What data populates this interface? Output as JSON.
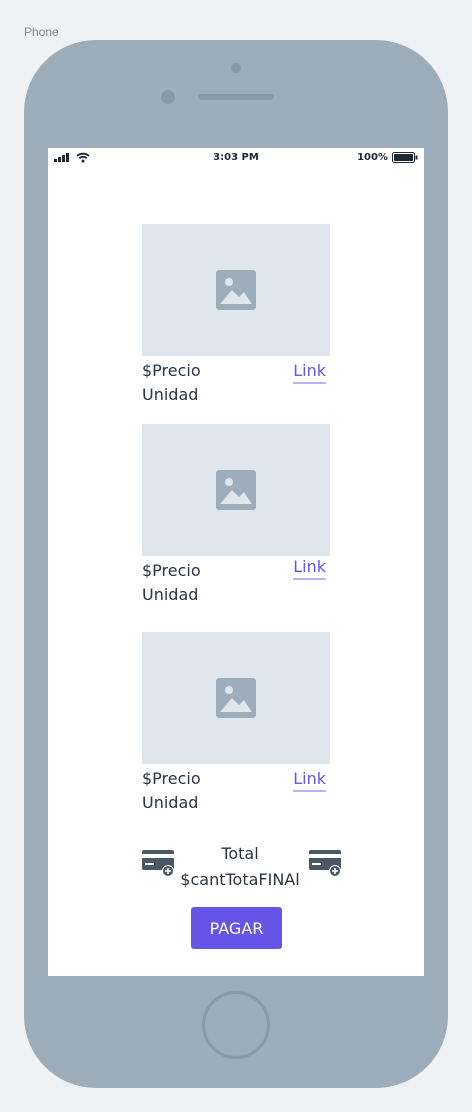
{
  "frame": {
    "label": "Phone"
  },
  "status_bar": {
    "time": "3:03 PM",
    "battery": "100%"
  },
  "products": [
    {
      "price": "$Precio Unidad",
      "link": "Link"
    },
    {
      "price": "$Precio Unidad",
      "link": "Link"
    },
    {
      "price": "$Precio Unidad",
      "link": "Link"
    }
  ],
  "summary": {
    "total_label": "Total",
    "total_value": "$cantTotaFINAl"
  },
  "actions": {
    "pay_label": "PAGAR"
  },
  "colors": {
    "accent": "#6554e8",
    "device": "#9eadba",
    "image_placeholder": "#dfe5ec",
    "text": "#2b3440"
  },
  "icons": [
    "signal-icon",
    "wifi-icon",
    "battery-icon",
    "image-placeholder-icon",
    "add-card-icon"
  ]
}
